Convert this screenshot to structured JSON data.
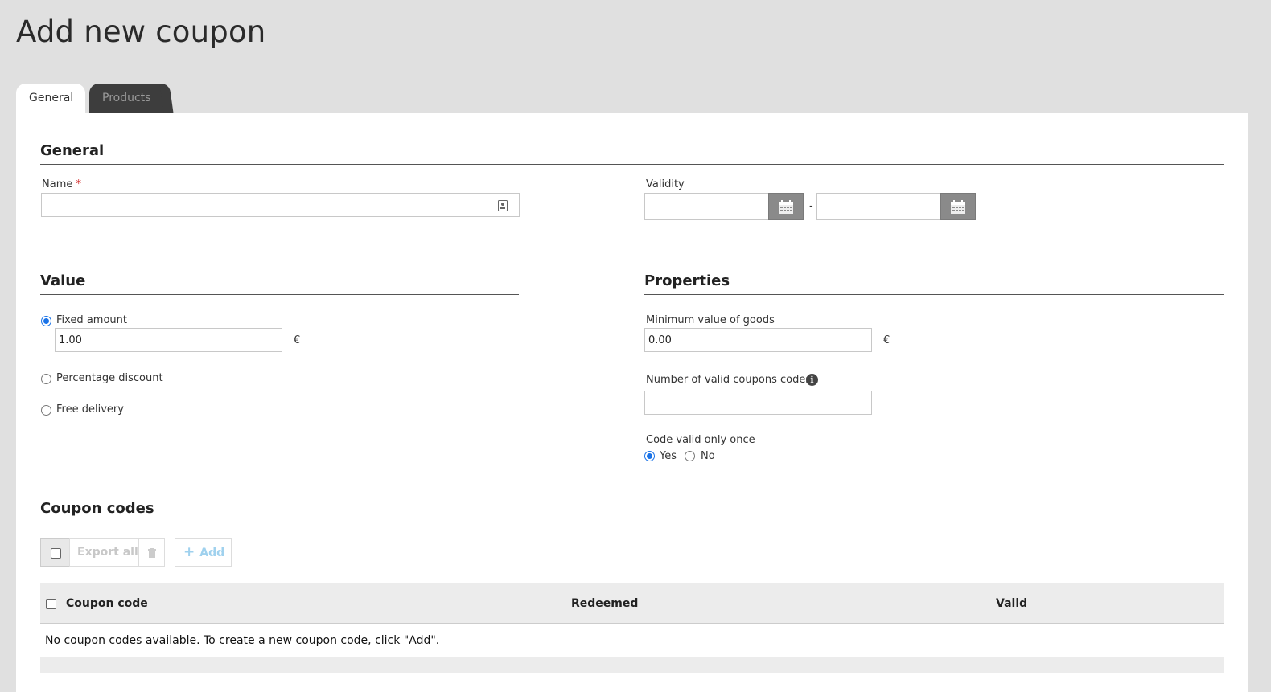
{
  "page": {
    "title": "Add new coupon"
  },
  "tabs": [
    {
      "label": "General",
      "active": true
    },
    {
      "label": "Products",
      "active": false
    }
  ],
  "general": {
    "section_title": "General",
    "name_label": "Name",
    "name_required": "*",
    "name_value": "",
    "validity_label": "Validity",
    "validity_from": "",
    "validity_separator": "-",
    "validity_to": ""
  },
  "value": {
    "section_title": "Value",
    "options": [
      {
        "label": "Fixed amount",
        "checked": true
      },
      {
        "label": "Percentage discount",
        "checked": false
      },
      {
        "label": "Free delivery",
        "checked": false
      }
    ],
    "fixed_amount_value": "1.00",
    "currency": "€"
  },
  "properties": {
    "section_title": "Properties",
    "min_value_label": "Minimum value of goods",
    "min_value": "0.00",
    "currency": "€",
    "num_codes_label": "Number of valid coupons codes",
    "num_codes_value": "",
    "once_label": "Code valid only once",
    "once_yes": "Yes",
    "once_no": "No",
    "once_selected": "Yes"
  },
  "coupon_codes": {
    "section_title": "Coupon codes",
    "toolbar": {
      "export_all": "Export all",
      "add": "Add"
    },
    "columns": [
      "Coupon code",
      "Redeemed",
      "Valid"
    ],
    "empty_message": "No coupon codes available. To create a new coupon code, click \"Add\"."
  },
  "icons": {
    "name_field": "contact-card-icon",
    "calendar": "calendar-icon",
    "info": "info-icon",
    "delete": "trash-icon",
    "add": "plus-icon"
  },
  "colors": {
    "background": "#e0e0e0",
    "panel": "#ffffff",
    "tab_inactive": "#3d3d3d",
    "accent": "#1a73e8",
    "required": "#d02020",
    "calendar_button": "#8a8a8a",
    "disabled_text": "#c8c8c8"
  }
}
